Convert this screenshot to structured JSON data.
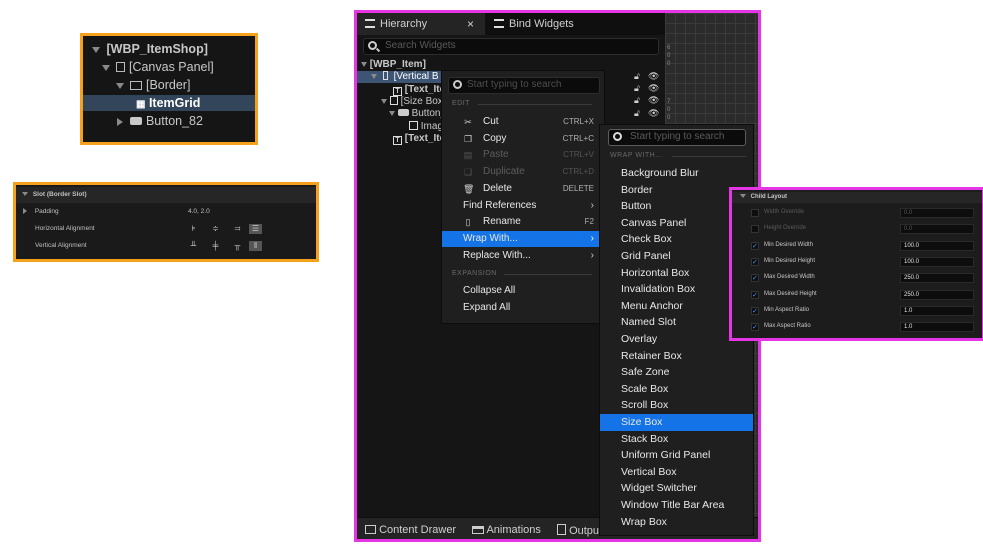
{
  "tree_panel": {
    "rows": [
      {
        "label": "[WBP_ItemShop]"
      },
      {
        "label": "[Canvas Panel]"
      },
      {
        "label": "[Border]"
      },
      {
        "label": "ItemGrid"
      },
      {
        "label": "Button_82"
      }
    ]
  },
  "slot_panel": {
    "header": "Slot (Border Slot)",
    "padding_label": "Padding",
    "padding_value": "4.0, 2.0",
    "horizontal_label": "Horizontal Alignment",
    "vertical_label": "Vertical Alignment"
  },
  "editor": {
    "tabs": [
      {
        "label": "Hierarchy"
      },
      {
        "label": "Bind Widgets"
      }
    ],
    "close_glyph": "×",
    "search_placeholder": "Search Widgets",
    "hierarchy": [
      {
        "label": "[WBP_Item]"
      },
      {
        "label": "[Vertical B"
      },
      {
        "label": "[Text_Ite"
      },
      {
        "label": "[Size Box"
      },
      {
        "label": "Button_"
      },
      {
        "label": "Imag"
      },
      {
        "label": "[Text_Ite"
      }
    ],
    "bottom_tabs": [
      {
        "label": "Content Drawer"
      },
      {
        "label": "Animations"
      },
      {
        "label": "Output"
      }
    ],
    "ruler_text": [
      "6",
      "0",
      "0",
      "7",
      "0",
      "0"
    ]
  },
  "context_menu": {
    "search_placeholder": "Start typing to search",
    "edit_header": "EDIT",
    "items": [
      {
        "label": "Cut",
        "shortcut": "CTRL+X"
      },
      {
        "label": "Copy",
        "shortcut": "CTRL+C"
      },
      {
        "label": "Paste",
        "shortcut": "CTRL+V"
      },
      {
        "label": "Duplicate",
        "shortcut": "CTRL+D"
      },
      {
        "label": "Delete",
        "shortcut": "DELETE"
      },
      {
        "label": "Find References",
        "shortcut": ""
      },
      {
        "label": "Rename",
        "shortcut": "F2"
      },
      {
        "label": "Wrap With...",
        "shortcut": ""
      },
      {
        "label": "Replace With...",
        "shortcut": ""
      }
    ],
    "expansion_header": "EXPANSION",
    "expansion_items": [
      {
        "label": "Collapse All"
      },
      {
        "label": "Expand All"
      }
    ]
  },
  "wrap_menu": {
    "search_placeholder": "Start typing to search",
    "header": "WRAP WITH...",
    "items": [
      {
        "label": "Background Blur"
      },
      {
        "label": "Border"
      },
      {
        "label": "Button"
      },
      {
        "label": "Canvas Panel"
      },
      {
        "label": "Check Box"
      },
      {
        "label": "Grid Panel"
      },
      {
        "label": "Horizontal Box"
      },
      {
        "label": "Invalidation Box"
      },
      {
        "label": "Menu Anchor"
      },
      {
        "label": "Named Slot"
      },
      {
        "label": "Overlay"
      },
      {
        "label": "Retainer Box"
      },
      {
        "label": "Safe Zone"
      },
      {
        "label": "Scale Box"
      },
      {
        "label": "Scroll Box"
      },
      {
        "label": "Size Box"
      },
      {
        "label": "Stack Box"
      },
      {
        "label": "Uniform Grid Panel"
      },
      {
        "label": "Vertical Box"
      },
      {
        "label": "Widget Switcher"
      },
      {
        "label": "Window Title Bar Area"
      },
      {
        "label": "Wrap Box"
      }
    ]
  },
  "child_layout": {
    "header": "Child Layout",
    "rows": [
      {
        "label": "Width Override",
        "value": "0.0"
      },
      {
        "label": "Height Override",
        "value": "0.0"
      },
      {
        "label": "Min Desired Width",
        "value": "100.0"
      },
      {
        "label": "Min Desired Height",
        "value": "100.0"
      },
      {
        "label": "Max Desired Width",
        "value": "250.0"
      },
      {
        "label": "Max Desired Height",
        "value": "250.0"
      },
      {
        "label": "Min Aspect Ratio",
        "value": "1.0"
      },
      {
        "label": "Max Aspect Ratio",
        "value": "1.0"
      }
    ]
  },
  "colors": {
    "orange_highlight": "#f5a11c",
    "magenta_highlight": "#e535e5",
    "selection_blue": "#1473e6"
  }
}
